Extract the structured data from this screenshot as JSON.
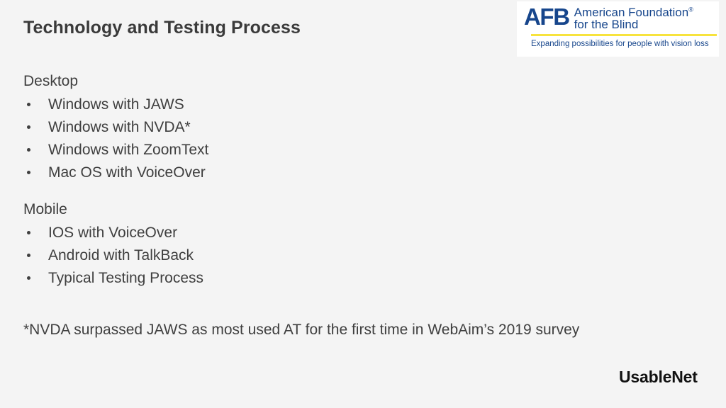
{
  "slide": {
    "title": "Technology and Testing Process",
    "background_color": "#f4f4f4",
    "text_color": "#3f3f3f"
  },
  "logo": {
    "mark": "AFB",
    "name_line1": "American Foundation",
    "registered_mark": "®",
    "name_line2": "for the Blind",
    "tagline": "Expanding possibilities for people with vision loss",
    "navy": "#17468c",
    "yellow": "#f7e33d"
  },
  "sections": [
    {
      "heading": "Desktop",
      "items": [
        "Windows with JAWS",
        "Windows with NVDA*",
        "Windows with ZoomText",
        "Mac OS with VoiceOver"
      ]
    },
    {
      "heading": "Mobile",
      "items": [
        "IOS with VoiceOver",
        "Android with TalkBack",
        "Typical Testing Process"
      ]
    }
  ],
  "footnote": "*NVDA surpassed JAWS as most used AT for the first time in WebAim’s 2019 survey",
  "brand": {
    "name": "UsableNet"
  }
}
